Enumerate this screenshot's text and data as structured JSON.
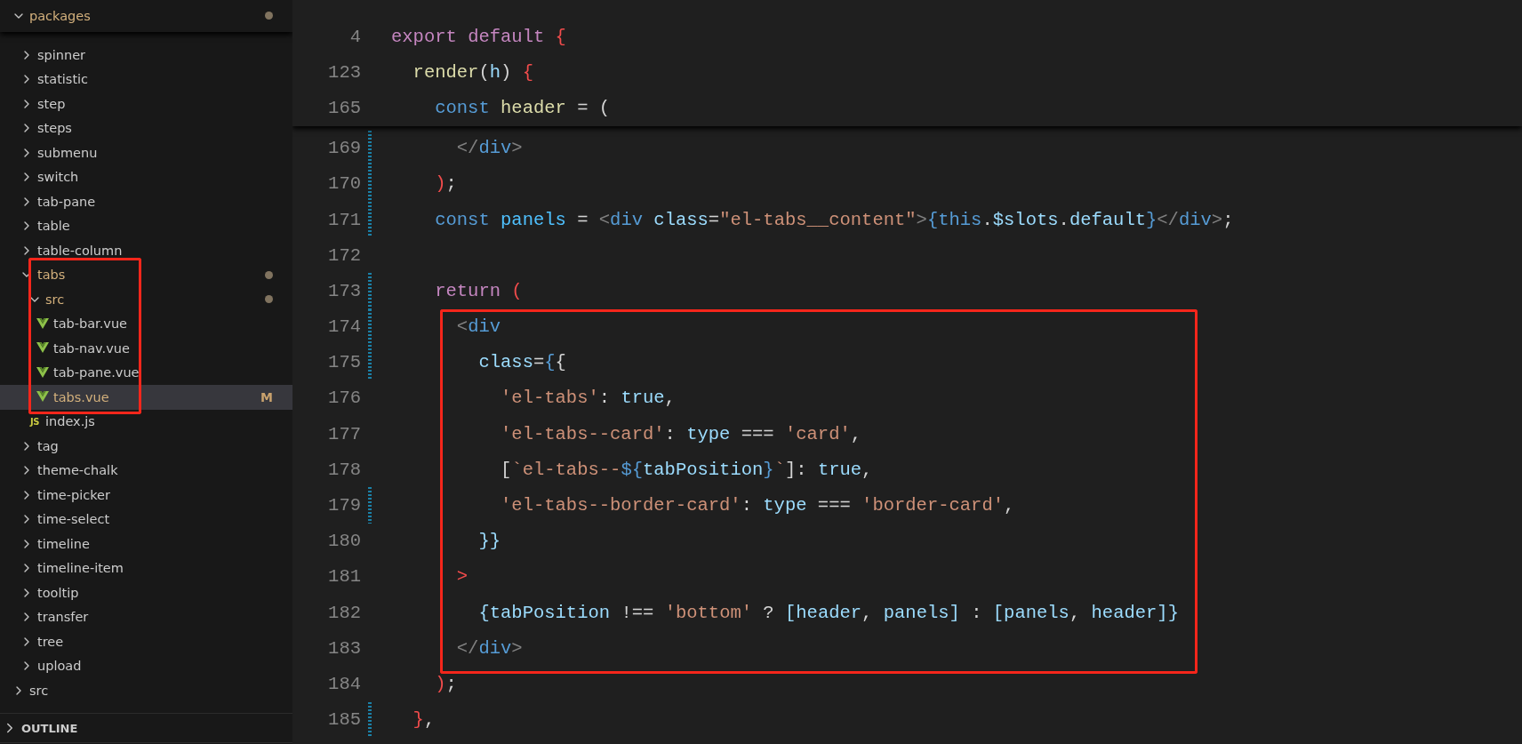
{
  "explorer": {
    "tree": [
      {
        "name": "packages",
        "kind": "folder",
        "expanded": true,
        "modified": true,
        "selected": false,
        "children": [
          {
            "name": "spinner",
            "kind": "folder",
            "expanded": false,
            "selected": false
          },
          {
            "name": "statistic",
            "kind": "folder",
            "expanded": false,
            "selected": false
          },
          {
            "name": "step",
            "kind": "folder",
            "expanded": false,
            "selected": false
          },
          {
            "name": "steps",
            "kind": "folder",
            "expanded": false,
            "selected": false
          },
          {
            "name": "submenu",
            "kind": "folder",
            "expanded": false,
            "selected": false
          },
          {
            "name": "switch",
            "kind": "folder",
            "expanded": false,
            "selected": false
          },
          {
            "name": "tab-pane",
            "kind": "folder",
            "expanded": false,
            "selected": false
          },
          {
            "name": "table",
            "kind": "folder",
            "expanded": false,
            "selected": false
          },
          {
            "name": "table-column",
            "kind": "folder",
            "expanded": false,
            "selected": false
          },
          {
            "name": "tabs",
            "kind": "folder",
            "expanded": true,
            "modified": true,
            "highlighted": true,
            "selected": false,
            "children": [
              {
                "name": "src",
                "kind": "folder",
                "expanded": true,
                "modified": true,
                "highlighted": true,
                "selected": false,
                "children": [
                  {
                    "name": "tab-bar.vue",
                    "kind": "vue",
                    "highlighted": true,
                    "selected": false
                  },
                  {
                    "name": "tab-nav.vue",
                    "kind": "vue",
                    "highlighted": true,
                    "selected": false
                  },
                  {
                    "name": "tab-pane.vue",
                    "kind": "vue",
                    "highlighted": true,
                    "selected": false
                  },
                  {
                    "name": "tabs.vue",
                    "kind": "vue",
                    "highlighted": true,
                    "modified": true,
                    "badge": "M",
                    "selected": true
                  }
                ]
              },
              {
                "name": "index.js",
                "kind": "js",
                "icon_label": "JS",
                "selected": false
              }
            ]
          },
          {
            "name": "tag",
            "kind": "folder",
            "expanded": false,
            "selected": false
          },
          {
            "name": "theme-chalk",
            "kind": "folder",
            "expanded": false,
            "selected": false
          },
          {
            "name": "time-picker",
            "kind": "folder",
            "expanded": false,
            "selected": false
          },
          {
            "name": "time-select",
            "kind": "folder",
            "expanded": false,
            "selected": false
          },
          {
            "name": "timeline",
            "kind": "folder",
            "expanded": false,
            "selected": false
          },
          {
            "name": "timeline-item",
            "kind": "folder",
            "expanded": false,
            "selected": false
          },
          {
            "name": "tooltip",
            "kind": "folder",
            "expanded": false,
            "selected": false
          },
          {
            "name": "transfer",
            "kind": "folder",
            "expanded": false,
            "selected": false
          },
          {
            "name": "tree",
            "kind": "folder",
            "expanded": false,
            "selected": false
          },
          {
            "name": "upload",
            "kind": "folder",
            "expanded": false,
            "selected": false
          }
        ]
      },
      {
        "name": "src",
        "kind": "folder",
        "expanded": false,
        "selected": false
      }
    ]
  },
  "outline": {
    "title": "OUTLINE",
    "expanded": false
  },
  "editor": {
    "sticky_lines": [
      {
        "number": "4",
        "code": "export default {"
      },
      {
        "number": "123",
        "code": "  render(h) {"
      },
      {
        "number": "165",
        "code": "    const header = ("
      }
    ],
    "lines": [
      {
        "number": "169",
        "changed": true,
        "highlighted": false,
        "code": "      </div>"
      },
      {
        "number": "170",
        "changed": true,
        "highlighted": false,
        "code": "    );"
      },
      {
        "number": "171",
        "changed": true,
        "highlighted": false,
        "code": "    const panels = <div class=\"el-tabs__content\">{this.$slots.default}</div>;"
      },
      {
        "number": "172",
        "changed": false,
        "highlighted": false
      },
      {
        "number": "173",
        "changed": true,
        "highlighted": false,
        "code": "    return ("
      },
      {
        "number": "174",
        "changed": true,
        "highlighted": true,
        "code": "      <div"
      },
      {
        "number": "175",
        "changed": true,
        "highlighted": true,
        "code": "        class={{"
      },
      {
        "number": "176",
        "changed": false,
        "highlighted": true,
        "code": "          'el-tabs': true,"
      },
      {
        "number": "177",
        "changed": false,
        "highlighted": true,
        "code": "          'el-tabs--card': type === 'card',"
      },
      {
        "number": "178",
        "changed": false,
        "highlighted": true,
        "code": "          [`el-tabs--${tabPosition}`]: true,"
      },
      {
        "number": "179",
        "changed": true,
        "highlighted": true,
        "code": "          'el-tabs--border-card': type === 'border-card',"
      },
      {
        "number": "180",
        "changed": false,
        "highlighted": true,
        "code": "        }}"
      },
      {
        "number": "181",
        "changed": false,
        "highlighted": true,
        "code": "      >"
      },
      {
        "number": "182",
        "changed": false,
        "highlighted": true,
        "code": "        {tabPosition !== 'bottom' ? [header, panels] : [panels, header]}"
      },
      {
        "number": "183",
        "changed": false,
        "highlighted": true,
        "code": "      </div>"
      },
      {
        "number": "184",
        "changed": false,
        "highlighted": false,
        "code": "    );"
      },
      {
        "number": "185",
        "changed": true,
        "highlighted": false,
        "code": "  },"
      }
    ]
  }
}
